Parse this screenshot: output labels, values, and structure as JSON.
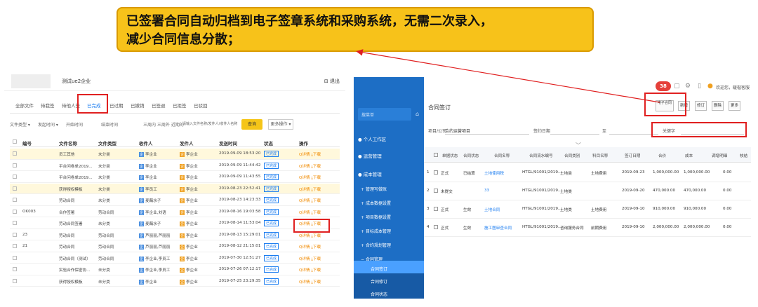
{
  "callout": {
    "line1": "已签署合同自动归档到电子签章系统和采购系统，无需二次录入，",
    "line2": "减少合同信息分散；"
  },
  "left": {
    "company": "测试ue2企业",
    "exit": "退出",
    "tabs": [
      "全部文件",
      "待我签",
      "待他人签",
      "已完成",
      "已过期",
      "已撤销",
      "已签退",
      "已拒签",
      "已驳回"
    ],
    "filters": {
      "file_type": "文件类型",
      "send_time": "发起时间",
      "start": "开始时间",
      "end": "结束时间",
      "quick": "三周内 三周外 近期的",
      "keyword": "请输入文件名称/发件人/收件人名称",
      "search": "查询",
      "more": "更多操作"
    },
    "headers": [
      "编号",
      "文件名称",
      "文件类型",
      "收件人",
      "发件人",
      "发送时间",
      "状态",
      "操作"
    ],
    "rows": [
      {
        "no": "",
        "name": "员工其他",
        "type": "未分类",
        "to": "李企业",
        "from": "李企业",
        "time": "2019-09-09 18:53:20",
        "status": "已完成"
      },
      {
        "no": "",
        "name": "平台问卷单2019...",
        "type": "未分类",
        "to": "李企业",
        "from": "李企业",
        "time": "2019-09-09 11:44:42",
        "status": "已完成"
      },
      {
        "no": "",
        "name": "平台问卷单2019...",
        "type": "未分类",
        "to": "李企业",
        "from": "李企业",
        "time": "2019-09-09 11:43:55",
        "status": "已完成"
      },
      {
        "no": "",
        "name": "获得授权模板",
        "type": "未分类",
        "to": "李员工",
        "from": "李企业",
        "time": "2019-08-23 22:52:41",
        "status": "已完成"
      },
      {
        "no": "",
        "name": "劳动合同",
        "type": "未分类",
        "to": "麦藕水子",
        "from": "李企业",
        "time": "2019-08-23 14:23:33",
        "status": "已完成"
      },
      {
        "no": "OK003",
        "name": "合作签署",
        "type": "劳动合同",
        "to": "李企业,刘语",
        "from": "李企业",
        "time": "2019-08-16 19:03:58",
        "status": "已完成"
      },
      {
        "no": "",
        "name": "劳动合同签署",
        "type": "未分类",
        "to": "麦藕水子",
        "from": "李企业",
        "time": "2019-08-14 11:53:04",
        "status": "已完成"
      },
      {
        "no": "23",
        "name": "劳动合同",
        "type": "劳动合同",
        "to": "芦丽丽,芦丽丽",
        "from": "李企业",
        "time": "2019-08-13 15:29:01",
        "status": "已完成"
      },
      {
        "no": "21",
        "name": "劳动合同",
        "type": "劳动合同",
        "to": "芦丽丽,芦丽丽",
        "from": "李企业",
        "time": "2019-08-12 21:15:01",
        "status": "已完成"
      },
      {
        "no": "",
        "name": "劳动合同（测试）",
        "type": "劳动合同",
        "to": "李企业,李员工",
        "from": "李企业",
        "time": "2019-07-30 12:51:27",
        "status": "已完成"
      },
      {
        "no": "",
        "name": "实验合作保密协...",
        "type": "未分类",
        "to": "李企业,李员工",
        "from": "李企业",
        "time": "2019-07-26 07:12:17",
        "status": "已完成"
      },
      {
        "no": "",
        "name": "获得授权模板",
        "type": "未分类",
        "to": "李企业",
        "from": "李企业",
        "time": "2019-07-25 23:29:35",
        "status": "已完成"
      }
    ],
    "ops_detail": "详情",
    "ops_download": "下载"
  },
  "right": {
    "badge": "38",
    "welcome": "欢迎您，暖楷客服",
    "page_title": "合同签订",
    "buttons": {
      "new": "电子合同",
      "save": "新增",
      "edit": "修订",
      "delete": "删除",
      "more": "更多"
    },
    "search": {
      "project_label": "项目/公司",
      "project_value": "合约运营项目",
      "date_label": "签约日期",
      "to": "至",
      "keyword_label": "关键字"
    },
    "sidebar": {
      "search_placeholder": "搜菜单",
      "items": [
        "个人工作区",
        "运营管理",
        "成本管理",
        "管理写做账",
        "成本数据设置",
        "项目数据设置",
        "目标成本管理",
        "合约规划管理",
        "合同管理",
        "合同签订",
        "合同修订",
        "合同状态"
      ]
    },
    "headers": [
      "",
      "单据状态",
      "合同状态",
      "合同名称",
      "合同流水编号",
      "合同类别",
      "科目名称",
      "签订日期",
      "合价",
      "成本",
      "调增明细",
      "核结"
    ],
    "rows": [
      {
        "idx": "1",
        "doc": "正式",
        "status": "已结算",
        "name": "土地使用税",
        "code": "HTGL/91001/2019...",
        "cat": "土地类",
        "subject": "土地费用",
        "date": "2019-09-23",
        "price": "1,000,000.00",
        "cost": "1,000,000.00",
        "adj": "0.00"
      },
      {
        "idx": "2",
        "doc": "未提交",
        "status": "",
        "name": "33",
        "code": "HTGL/91001/2019...",
        "cat": "土地类",
        "subject": "",
        "date": "2019-09-20",
        "price": "470,000.00",
        "cost": "470,000.00",
        "adj": "0.00"
      },
      {
        "idx": "3",
        "doc": "正式",
        "status": "生效",
        "name": "土地合同",
        "code": "HTGL/91001/2019...",
        "cat": "土地类",
        "subject": "土地费用",
        "date": "2019-09-10",
        "price": "910,000.00",
        "cost": "910,000.00",
        "adj": "0.00"
      },
      {
        "idx": "4",
        "doc": "正式",
        "status": "生效",
        "name": "施工图审查合同",
        "code": "HTGL/91001/2019...",
        "cat": "咨询服务合同",
        "subject": "前期费用",
        "date": "2019-09-10",
        "price": "2,000,000.00",
        "cost": "2,000,000.00",
        "adj": "0.00"
      }
    ]
  }
}
